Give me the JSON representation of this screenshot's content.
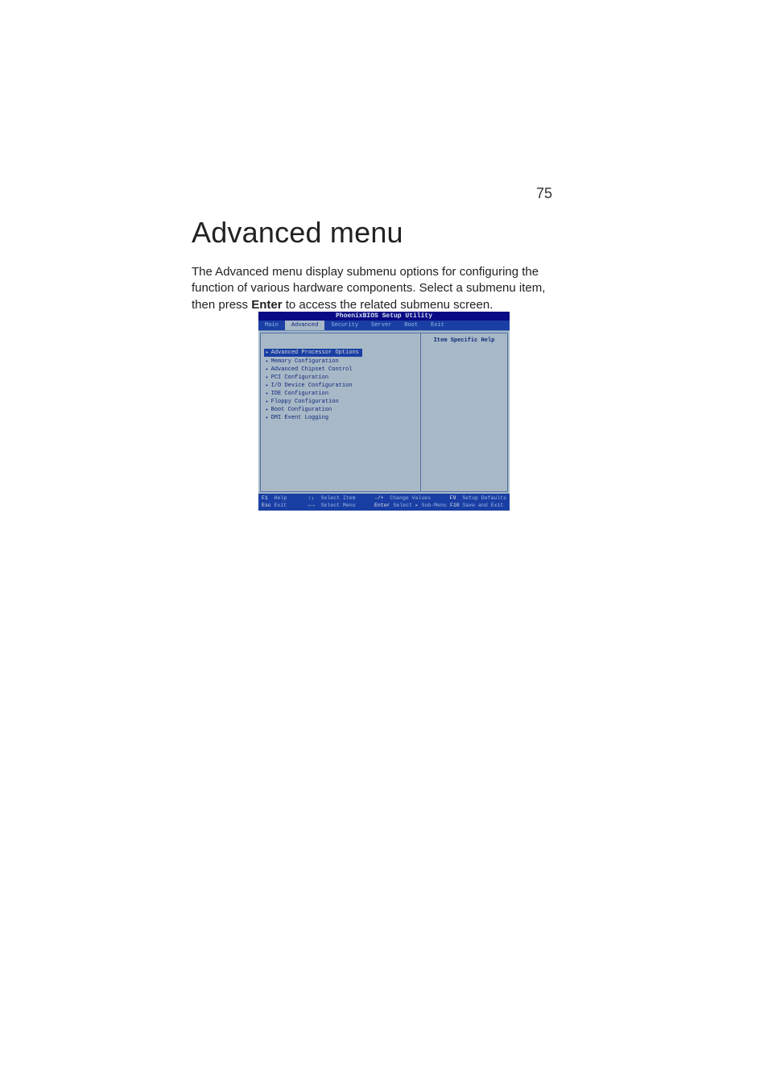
{
  "page_number": "75",
  "heading": "Advanced menu",
  "paragraph_pre": "The Advanced menu display submenu options for configuring the function of various hardware components.  Select a submenu item, then press ",
  "paragraph_bold": "Enter",
  "paragraph_post": " to access the related submenu screen.",
  "bios": {
    "title": "PhoenixBIOS Setup Utility",
    "tabs": [
      "Main",
      "Advanced",
      "Security",
      "Server",
      "Boot",
      "Exit"
    ],
    "active_tab_index": 1,
    "help_title": "Item Specific Help",
    "items": [
      "Advanced Processor Options",
      "Memory Configuration",
      "Advanced Chipset Control",
      "PCI Configuration",
      "I/O Device Configuration",
      "IDE Configuration",
      "Floppy Configuration",
      "Boot Configuration",
      "DMI Event Logging"
    ],
    "selected_item_index": 0,
    "footer": {
      "row1": {
        "k1": "F1",
        "v1": "Help",
        "k2": "↑↓",
        "v2": "Select Item",
        "k3": "-/+",
        "v3": "Change Values",
        "k4": "F9",
        "v4": "Setup Defaults"
      },
      "row2": {
        "k1": "Esc",
        "v1": "Exit",
        "k2": "←→",
        "v2": "Select Menu",
        "k3": "Enter",
        "v3": "Select ▸ Sub-Menu",
        "k4": "F10",
        "v4": "Save and Exit"
      }
    }
  }
}
